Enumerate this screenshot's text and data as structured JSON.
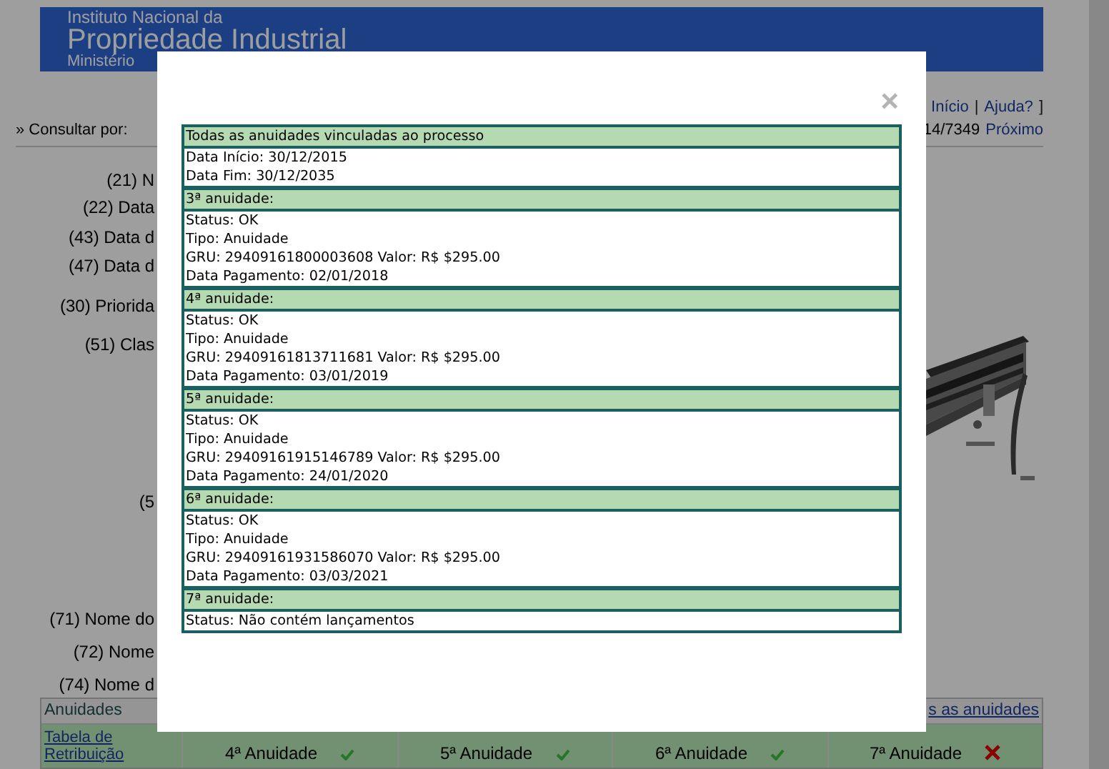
{
  "header": {
    "line1": "Instituto Nacional da",
    "title": "Propriedade Industrial",
    "line3": "Ministério"
  },
  "top_links": [
    {
      "label": "Início",
      "kind": "link"
    },
    {
      "label": "|",
      "kind": "text"
    },
    {
      "label": "Ajuda?",
      "kind": "link"
    },
    {
      "label": "]",
      "kind": "text"
    }
  ],
  "consult_label": "» Consultar por:",
  "pager": {
    "position": "14/7349",
    "next": "Próximo"
  },
  "fields": [
    "(21) N",
    "(22) Data",
    "(43) Data d",
    "(47) Data d",
    "(30) Priorida",
    "(51) Clas",
    "(5",
    "(71) Nome do",
    "(72) Nome",
    "(74) Nome d"
  ],
  "annuities_table": {
    "title": "Anuidades",
    "all_link": "s as anuidades",
    "fee_link": "Tabela de Retribuição",
    "cells": [
      {
        "label": "4ª Anuidade",
        "paid": true
      },
      {
        "label": "5ª Anuidade",
        "paid": true
      },
      {
        "label": "6ª Anuidade",
        "paid": true
      },
      {
        "label": "7ª Anuidade",
        "paid": false
      }
    ]
  },
  "modal": {
    "close": "×",
    "sections": [
      {
        "title": "Todas as anuidades vinculadas ao processo",
        "lines": [
          "Data Início: 30/12/2015",
          "Data Fim: 30/12/2035"
        ]
      },
      {
        "title": "3ª anuidade:",
        "lines": [
          "Status: OK",
          "Tipo: Anuidade",
          "GRU: 29409161800003608 Valor: R$ $295.00",
          "Data Pagamento: 02/01/2018"
        ]
      },
      {
        "title": "4ª anuidade:",
        "lines": [
          "Status: OK",
          "Tipo: Anuidade",
          "GRU: 29409161813711681 Valor: R$ $295.00",
          "Data Pagamento: 03/01/2019"
        ]
      },
      {
        "title": "5ª anuidade:",
        "lines": [
          "Status: OK",
          "Tipo: Anuidade",
          "GRU: 29409161915146789 Valor: R$ $295.00",
          "Data Pagamento: 24/01/2020"
        ]
      },
      {
        "title": "6ª anuidade:",
        "lines": [
          "Status: OK",
          "Tipo: Anuidade",
          "GRU: 29409161931586070 Valor: R$ $295.00",
          "Data Pagamento: 03/03/2021"
        ]
      },
      {
        "title": "7ª anuidade:",
        "lines": [
          "Status: Não contém lançamentos"
        ]
      }
    ]
  }
}
